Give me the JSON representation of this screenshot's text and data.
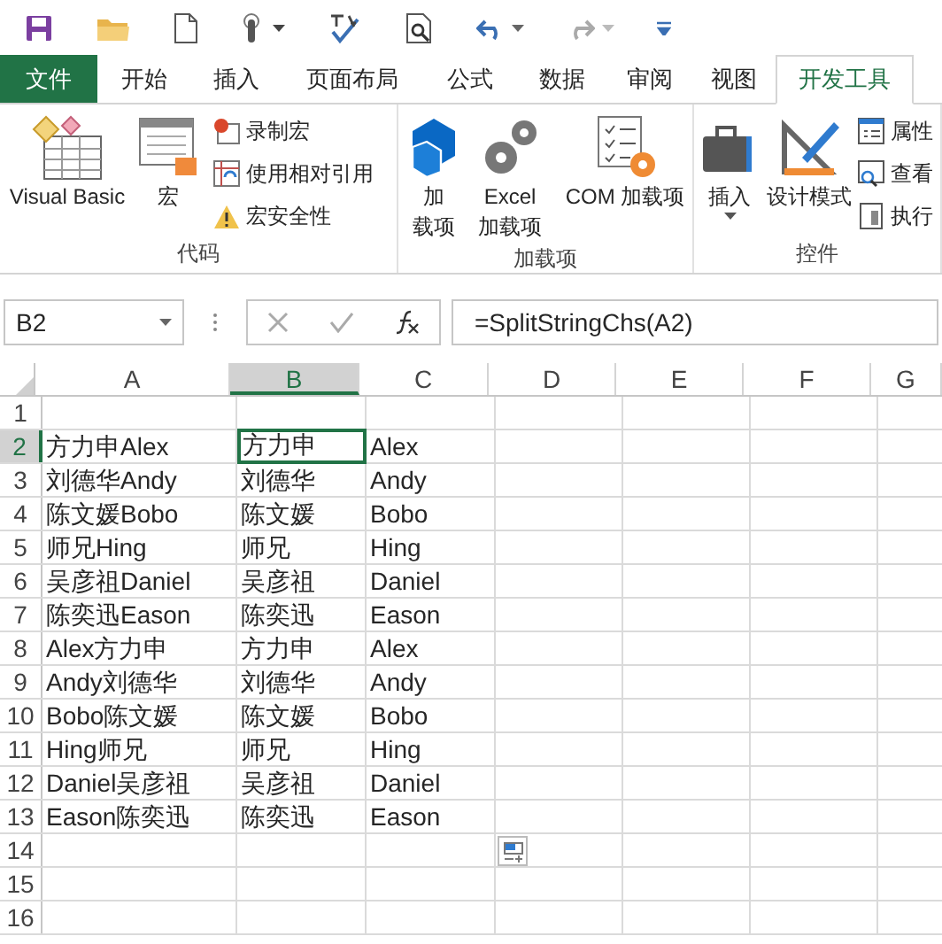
{
  "tabs": [
    {
      "label": "文件",
      "kind": "file",
      "selected": false
    },
    {
      "label": "开始",
      "kind": "tab",
      "selected": false
    },
    {
      "label": "插入",
      "kind": "tab",
      "selected": false
    },
    {
      "label": "页面布局",
      "kind": "tab",
      "selected": false
    },
    {
      "label": "公式",
      "kind": "tab",
      "selected": false
    },
    {
      "label": "数据",
      "kind": "tab",
      "selected": false
    },
    {
      "label": "审阅",
      "kind": "tab",
      "selected": false
    },
    {
      "label": "视图",
      "kind": "tab",
      "selected": false
    },
    {
      "label": "开发工具",
      "kind": "tab",
      "selected": true
    }
  ],
  "ribbon": {
    "groups": [
      {
        "label": "代码",
        "large_buttons": [
          {
            "lines": [
              "Visual Basic"
            ]
          },
          {
            "lines": [
              "宏"
            ]
          }
        ],
        "small_buttons": [
          {
            "label": "录制宏"
          },
          {
            "label": "使用相对引用"
          },
          {
            "label": "宏安全性"
          }
        ]
      },
      {
        "label": "加载项",
        "large_buttons": [
          {
            "lines": [
              "加",
              "载项"
            ]
          },
          {
            "lines": [
              "Excel",
              "加载项"
            ]
          },
          {
            "lines": [
              "COM 加载项"
            ]
          }
        ]
      },
      {
        "label": "控件",
        "large_buttons": [
          {
            "lines": [
              "插入"
            ],
            "dropdown": true
          },
          {
            "lines": [
              "设计模式"
            ]
          }
        ],
        "small_buttons": [
          {
            "label": "属性"
          },
          {
            "label": "查看"
          },
          {
            "label": "执行"
          }
        ]
      }
    ]
  },
  "name_box": {
    "value": "B2"
  },
  "formula_bar": {
    "value": "=SplitStringChs(A2)"
  },
  "columns": [
    {
      "label": "A",
      "selected": false
    },
    {
      "label": "B",
      "selected": true
    },
    {
      "label": "C",
      "selected": false
    },
    {
      "label": "D",
      "selected": false
    },
    {
      "label": "E",
      "selected": false
    },
    {
      "label": "F",
      "selected": false
    },
    {
      "label": "G",
      "selected": false
    }
  ],
  "rows": [
    {
      "number": "1",
      "selected": false
    },
    {
      "number": "2",
      "selected": true,
      "cells": [
        {
          "text": "方力申Alex",
          "selected": false
        },
        {
          "text": "方力申",
          "selected": true
        },
        {
          "text": "Alex",
          "selected": false
        }
      ]
    },
    {
      "number": "3",
      "selected": false,
      "cells": [
        {
          "text": "刘德华Andy",
          "selected": false
        },
        {
          "text": "刘德华",
          "selected": false
        },
        {
          "text": "Andy",
          "selected": false
        }
      ]
    },
    {
      "number": "4",
      "selected": false,
      "cells": [
        {
          "text": "陈文媛Bobo",
          "selected": false
        },
        {
          "text": "陈文媛",
          "selected": false
        },
        {
          "text": "Bobo",
          "selected": false
        }
      ]
    },
    {
      "number": "5",
      "selected": false,
      "cells": [
        {
          "text": "师兄Hing",
          "selected": false
        },
        {
          "text": "师兄",
          "selected": false
        },
        {
          "text": "Hing",
          "selected": false
        }
      ]
    },
    {
      "number": "6",
      "selected": false,
      "cells": [
        {
          "text": "吴彦祖Daniel",
          "selected": false
        },
        {
          "text": "吴彦祖",
          "selected": false
        },
        {
          "text": "Daniel",
          "selected": false
        }
      ]
    },
    {
      "number": "7",
      "selected": false,
      "cells": [
        {
          "text": "陈奕迅Eason",
          "selected": false
        },
        {
          "text": "陈奕迅",
          "selected": false
        },
        {
          "text": "Eason",
          "selected": false
        }
      ]
    },
    {
      "number": "8",
      "selected": false,
      "cells": [
        {
          "text": "Alex方力申",
          "selected": false
        },
        {
          "text": "方力申",
          "selected": false
        },
        {
          "text": "Alex",
          "selected": false
        }
      ]
    },
    {
      "number": "9",
      "selected": false,
      "cells": [
        {
          "text": "Andy刘德华",
          "selected": false
        },
        {
          "text": "刘德华",
          "selected": false
        },
        {
          "text": "Andy",
          "selected": false
        }
      ]
    },
    {
      "number": "10",
      "selected": false,
      "cells": [
        {
          "text": "Bobo陈文媛",
          "selected": false
        },
        {
          "text": "陈文媛",
          "selected": false
        },
        {
          "text": "Bobo",
          "selected": false
        }
      ]
    },
    {
      "number": "11",
      "selected": false,
      "cells": [
        {
          "text": "Hing师兄",
          "selected": false
        },
        {
          "text": "师兄",
          "selected": false
        },
        {
          "text": "Hing",
          "selected": false
        }
      ]
    },
    {
      "number": "12",
      "selected": false,
      "cells": [
        {
          "text": "Daniel吴彦祖",
          "selected": false
        },
        {
          "text": "吴彦祖",
          "selected": false
        },
        {
          "text": "Daniel",
          "selected": false
        }
      ]
    },
    {
      "number": "13",
      "selected": false,
      "cells": [
        {
          "text": "Eason陈奕迅",
          "selected": false
        },
        {
          "text": "陈奕迅",
          "selected": false
        },
        {
          "text": "Eason",
          "selected": false
        }
      ]
    },
    {
      "number": "14",
      "selected": false
    },
    {
      "number": "15",
      "selected": false
    },
    {
      "number": "16",
      "selected": false
    }
  ]
}
